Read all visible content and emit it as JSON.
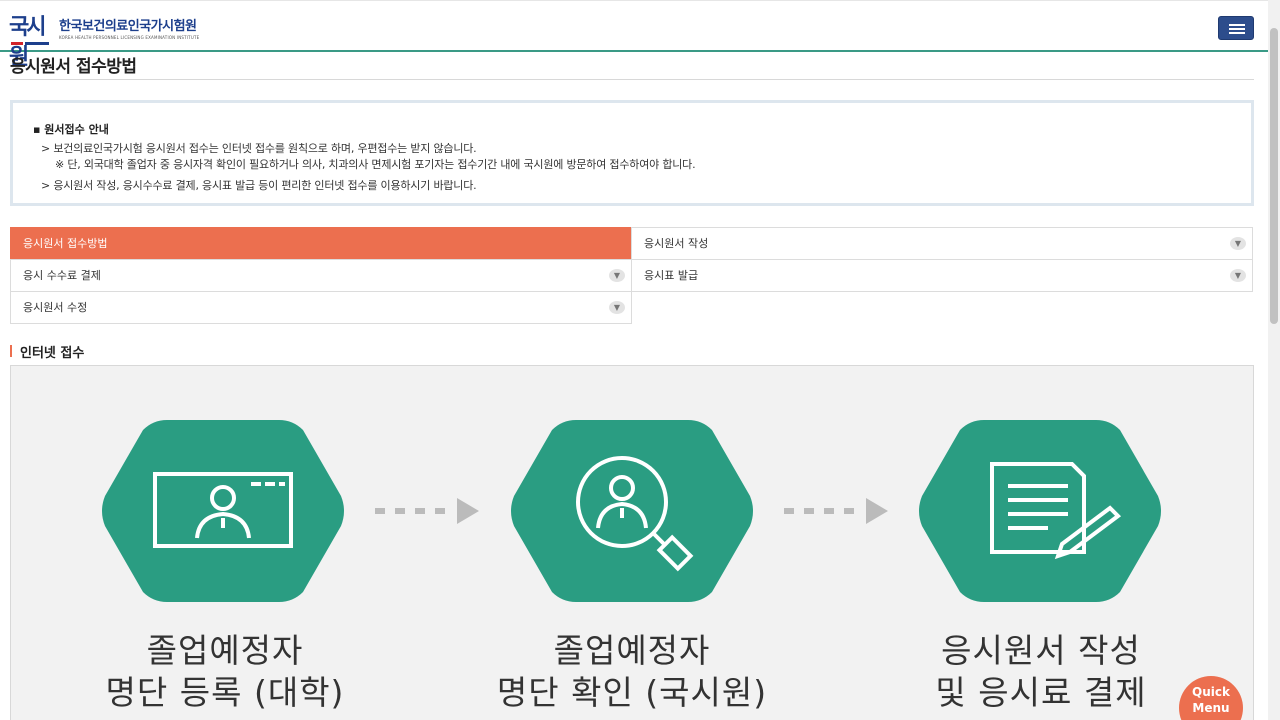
{
  "header": {
    "logo_mark": "국시원",
    "logo_ko": "한국보건의료인국가시험원",
    "logo_en": "KOREA HEALTH PERSONNEL LICENSING EXAMINATION INSTITUTE",
    "menu_icon": "hamburger-icon"
  },
  "page": {
    "title": "응시원서 접수방법"
  },
  "notice": {
    "head": "▪ 원서접수 안내",
    "line1": "> 보건의료인국가시험 응시원서 접수는 인터넷 접수를 원칙으로 하며, 우편접수는 받지 않습니다.",
    "line2": "※ 단, 외국대학 졸업자 중 응시자격 확인이 필요하거나 의사, 치과의사 면제시험 포기자는 접수기간 내에 국시원에 방문하여 접수하여야 합니다.",
    "line3": "> 응시원서 작성, 응시수수료 결제, 응시표 발급 등이 편리한 인터넷 접수를 이용하시기 바랍니다."
  },
  "tabs": [
    {
      "label": "응시원서 접수방법",
      "active": true
    },
    {
      "label": "응시원서 작성",
      "active": false
    },
    {
      "label": "응시 수수료 결제",
      "active": false
    },
    {
      "label": "응시표 발급",
      "active": false
    },
    {
      "label": "응시원서 수정",
      "active": false
    }
  ],
  "section": {
    "title": "인터넷 접수"
  },
  "steps": [
    {
      "line1": "졸업예정자",
      "line2": "명단 등록 (대학)",
      "icon": "monitor-person-icon"
    },
    {
      "line1": "졸업예정자",
      "line2": "명단 확인 (국시원)",
      "icon": "magnifier-person-icon"
    },
    {
      "line1": "응시원서 작성",
      "line2": "및 응시료 결제",
      "icon": "document-pen-icon"
    }
  ],
  "quick_menu": {
    "line1": "Quick",
    "line2": "Menu"
  },
  "colors": {
    "accent": "#ec6f4f",
    "hex_green": "#2a9d82",
    "brand_navy": "#1d3f8c"
  }
}
